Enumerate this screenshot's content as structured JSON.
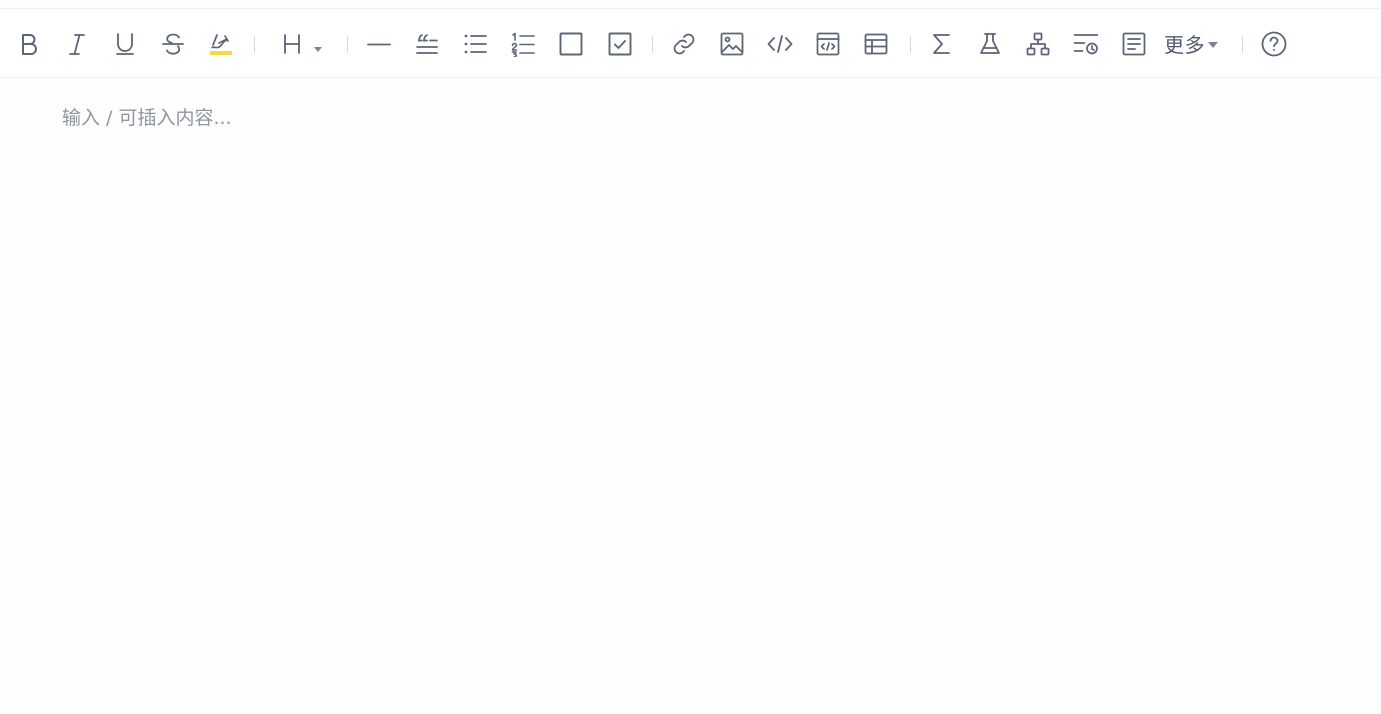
{
  "toolbar": {
    "buttons": [
      {
        "id": "bold",
        "icon": "bold-icon"
      },
      {
        "id": "italic",
        "icon": "italic-icon"
      },
      {
        "id": "underline",
        "icon": "underline-icon"
      },
      {
        "id": "strikethrough",
        "icon": "strikethrough-icon"
      },
      {
        "id": "highlight",
        "icon": "highlight-icon"
      },
      {
        "id": "heading",
        "icon": "heading-icon",
        "dropdown": true
      },
      {
        "id": "horizontal-rule",
        "icon": "horizontal-rule-icon"
      },
      {
        "id": "blockquote",
        "icon": "blockquote-icon"
      },
      {
        "id": "bullet-list",
        "icon": "bullet-list-icon"
      },
      {
        "id": "ordered-list",
        "icon": "ordered-list-icon"
      },
      {
        "id": "checkbox",
        "icon": "checkbox-icon"
      },
      {
        "id": "task-list",
        "icon": "task-list-icon"
      },
      {
        "id": "link",
        "icon": "link-icon"
      },
      {
        "id": "image",
        "icon": "image-icon"
      },
      {
        "id": "code",
        "icon": "code-icon"
      },
      {
        "id": "code-block",
        "icon": "code-block-icon"
      },
      {
        "id": "table",
        "icon": "table-icon"
      },
      {
        "id": "formula",
        "icon": "sigma-icon"
      },
      {
        "id": "flask",
        "icon": "flask-icon"
      },
      {
        "id": "mindmap",
        "icon": "mindmap-icon"
      },
      {
        "id": "timeline",
        "icon": "timeline-icon"
      },
      {
        "id": "document",
        "icon": "document-icon"
      },
      {
        "id": "help",
        "icon": "help-icon"
      }
    ],
    "more_label": "更多",
    "highlight_color": "#f9d548",
    "icon_color": "#5b6576"
  },
  "editor": {
    "placeholder": "输入 / 可插入内容..."
  }
}
